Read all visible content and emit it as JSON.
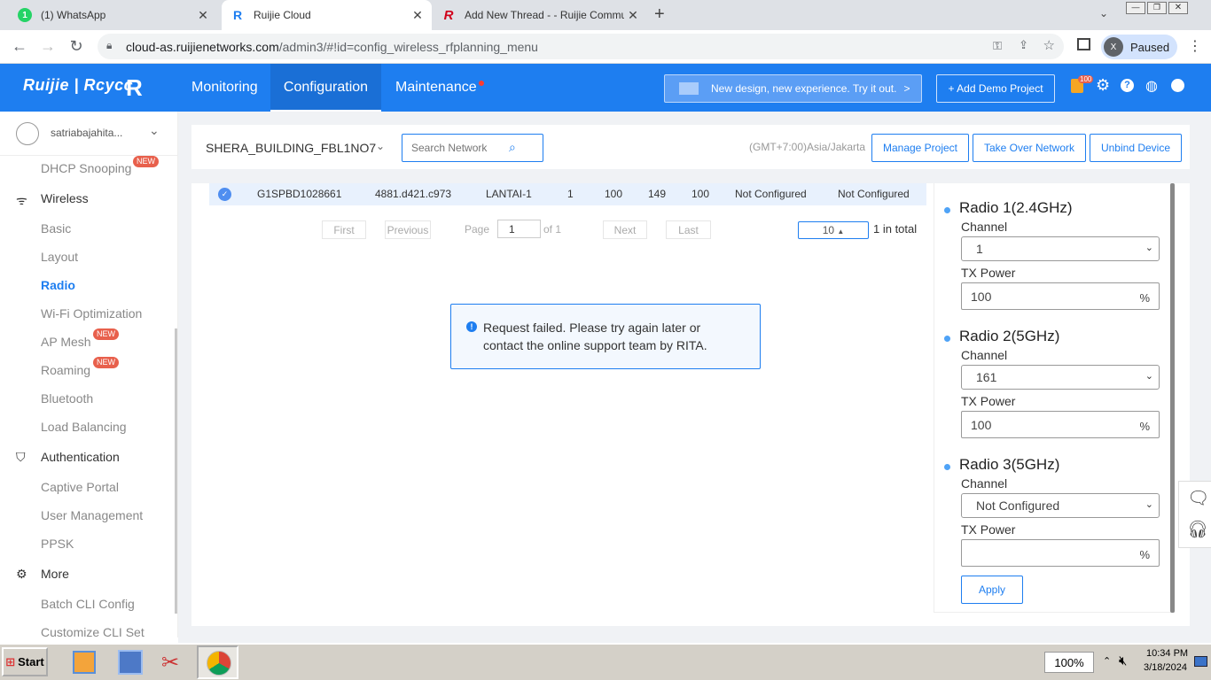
{
  "browser": {
    "tabs": [
      {
        "label": "(1) WhatsApp",
        "badge": "1"
      },
      {
        "label": "Ruijie Cloud"
      },
      {
        "label": "Add New Thread - - Ruijie Communit"
      }
    ],
    "url_host": "cloud-as.ruijienetworks.com",
    "url_path": "/admin3/#!id=config_wireless_rfplanning_menu",
    "profile_initial": "X",
    "profile_status": "Paused"
  },
  "header": {
    "logo": "Ruijie | Rcycc",
    "menu": [
      "Monitoring",
      "Configuration",
      "Maintenance"
    ],
    "banner": "New design, new experience. Try it out.",
    "add_demo": "+ Add Demo Project",
    "cart_badge": "100",
    "colors": {
      "primary": "#1e7ef0",
      "accent_dot": "#ff3b30"
    }
  },
  "sidebar": {
    "user": "satriabajahita...",
    "items": [
      {
        "label": "DHCP Snooping",
        "new": "NEW"
      },
      {
        "label": "Wireless",
        "group": true
      },
      {
        "label": "Basic"
      },
      {
        "label": "Layout"
      },
      {
        "label": "Radio",
        "active": true
      },
      {
        "label": "Wi-Fi Optimization"
      },
      {
        "label": "AP Mesh",
        "new": "NEW"
      },
      {
        "label": "Roaming",
        "new": "NEW"
      },
      {
        "label": "Bluetooth"
      },
      {
        "label": "Load Balancing"
      },
      {
        "label": "Authentication",
        "group": true
      },
      {
        "label": "Captive Portal"
      },
      {
        "label": "User Management"
      },
      {
        "label": "PPSK"
      },
      {
        "label": "More",
        "group": true
      },
      {
        "label": "Batch CLI Config"
      },
      {
        "label": "Customize CLI Set"
      }
    ]
  },
  "toolbar": {
    "network": "SHERA_BUILDING_FBL1NO7",
    "search_placeholder": "Search Network",
    "timezone": "(GMT+7:00)Asia/Jakarta",
    "manage_project": "Manage Project",
    "take_over": "Take Over Network",
    "unbind": "Unbind Device"
  },
  "table": {
    "row": [
      "G1SPBD1028661",
      "4881.d421.c973",
      "LANTAI-1",
      "1",
      "100",
      "149",
      "100",
      "Not Configured",
      "Not Configured"
    ]
  },
  "pagination": {
    "first": "First",
    "previous": "Previous",
    "page_label": "Page",
    "page_value": "1",
    "of": "of 1",
    "next": "Next",
    "last": "Last",
    "page_size": "10",
    "total": "1 in total"
  },
  "alert": {
    "line1": "Request failed. Please try again later or",
    "line2": "contact the online support team by RITA."
  },
  "radio_panel": {
    "channel_label": "Channel",
    "tx_label": "TX Power",
    "pct": "%",
    "radios": [
      {
        "title": "Radio 1(2.4GHz)",
        "channel": "1",
        "tx": "100"
      },
      {
        "title": "Radio 2(5GHz)",
        "channel": "161",
        "tx": "100"
      },
      {
        "title": "Radio 3(5GHz)",
        "channel": "Not Configured",
        "tx": ""
      }
    ],
    "apply": "Apply"
  },
  "taskbar": {
    "start": "Start",
    "zoom": "100%",
    "time": "10:34 PM",
    "date": "3/18/2024"
  }
}
